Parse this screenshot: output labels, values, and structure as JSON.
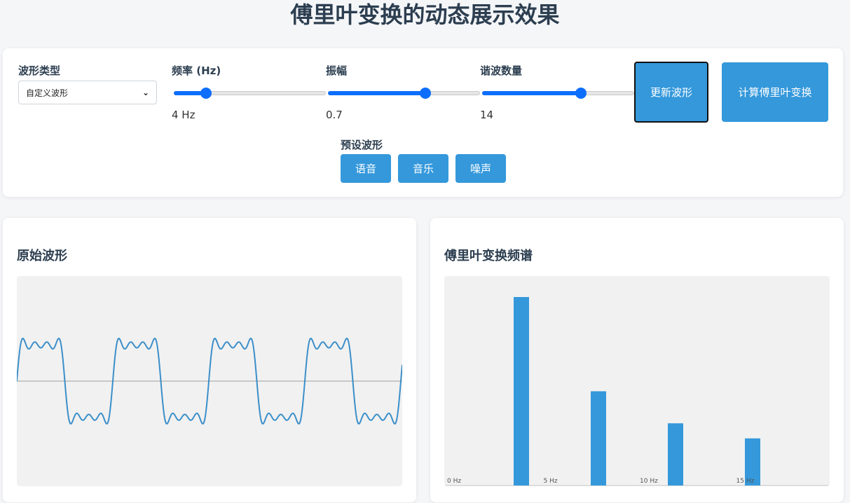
{
  "page": {
    "title": "傅里叶变换的动态展示效果"
  },
  "controls": {
    "waveform_type_label": "波形类型",
    "waveform_type_value": "自定义波形",
    "frequency": {
      "label": "频率 (Hz)",
      "value_text": "4 Hz",
      "fraction": 0.21
    },
    "amplitude": {
      "label": "振幅",
      "value_text": "0.7",
      "fraction": 0.64
    },
    "harmonics": {
      "label": "谐波数量",
      "value_text": "14",
      "fraction": 0.65
    },
    "update_button": "更新波形",
    "fft_button": "计算傅里叶变换",
    "preset_label": "预设波形",
    "presets": [
      "语音",
      "音乐",
      "噪声"
    ]
  },
  "waveform_panel": {
    "title": "原始波形"
  },
  "spectrum_panel": {
    "title": "傅里叶变换频谱"
  },
  "colors": {
    "accent": "#3498db",
    "slider": "#0d6efd",
    "plot_bg": "#f1f1f1"
  },
  "chart_data": [
    {
      "type": "line",
      "series": [
        {
          "function": "square-wave fourier approximation",
          "frequency_hz": 4,
          "amplitude": 0.7,
          "odd_harmonics": [
            1,
            3,
            5,
            7
          ]
        }
      ]
    },
    {
      "type": "bar",
      "x": [
        4,
        8,
        12,
        16
      ],
      "values": [
        1.0,
        0.5,
        0.33,
        0.25
      ],
      "tick_labels": [
        "0 Hz",
        "5 Hz",
        "10 Hz",
        "15 Hz"
      ],
      "tick_values": [
        0,
        5,
        10,
        15
      ],
      "xlim": [
        0,
        20
      ],
      "ylim": [
        0,
        1.1
      ]
    }
  ]
}
